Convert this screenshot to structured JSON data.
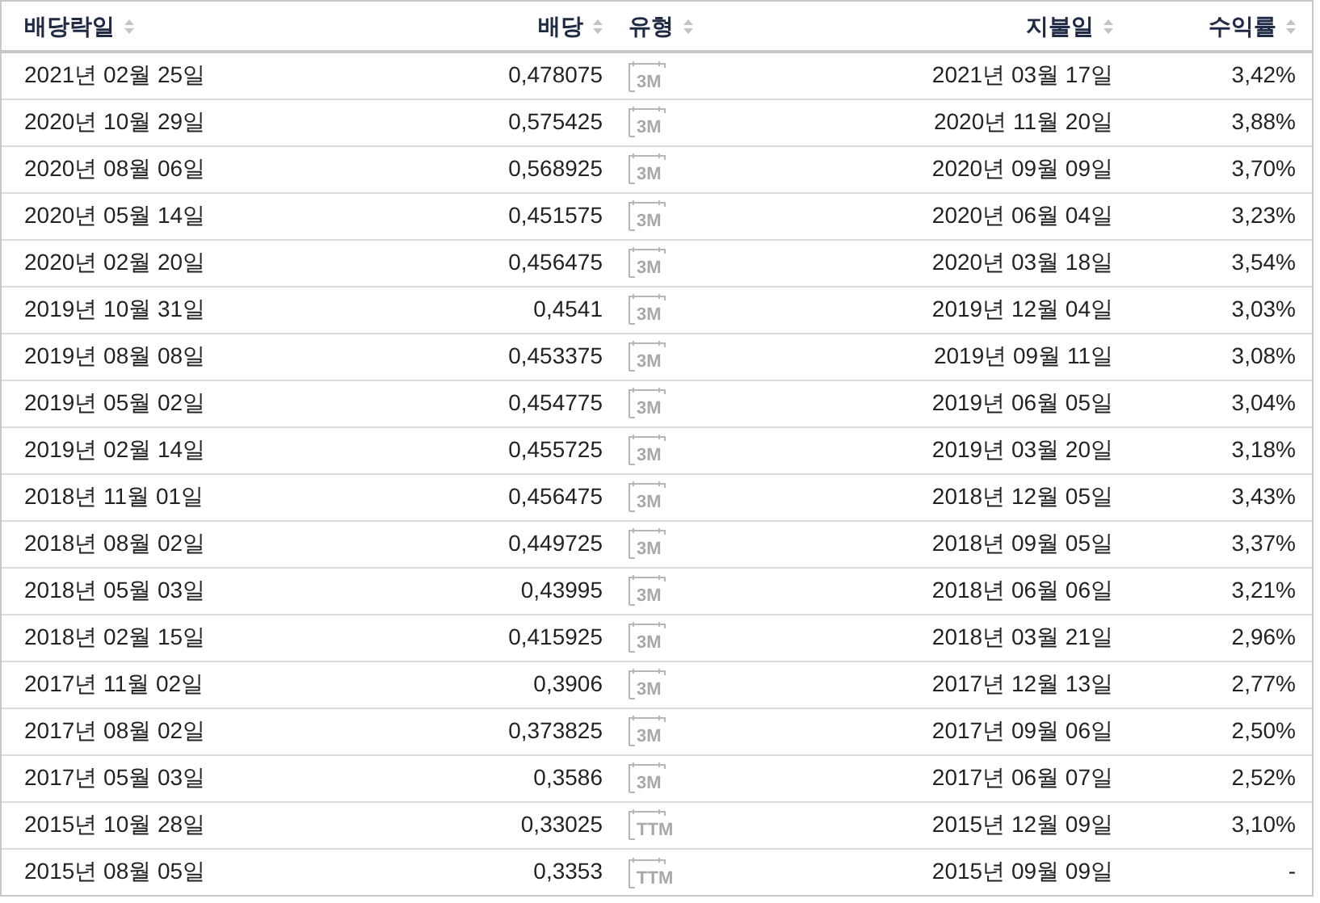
{
  "table": {
    "columns": [
      {
        "label": "배당락일"
      },
      {
        "label": "배당"
      },
      {
        "label": "유형"
      },
      {
        "label": "지불일"
      },
      {
        "label": "수익률"
      }
    ],
    "rows": [
      {
        "ex_date": "2021년 02월 25일",
        "dividend": "0,478075",
        "type": "3M",
        "pay_date": "2021년 03월 17일",
        "yield": "3,42%"
      },
      {
        "ex_date": "2020년 10월 29일",
        "dividend": "0,575425",
        "type": "3M",
        "pay_date": "2020년 11월 20일",
        "yield": "3,88%"
      },
      {
        "ex_date": "2020년 08월 06일",
        "dividend": "0,568925",
        "type": "3M",
        "pay_date": "2020년 09월 09일",
        "yield": "3,70%"
      },
      {
        "ex_date": "2020년 05월 14일",
        "dividend": "0,451575",
        "type": "3M",
        "pay_date": "2020년 06월 04일",
        "yield": "3,23%"
      },
      {
        "ex_date": "2020년 02월 20일",
        "dividend": "0,456475",
        "type": "3M",
        "pay_date": "2020년 03월 18일",
        "yield": "3,54%"
      },
      {
        "ex_date": "2019년 10월 31일",
        "dividend": "0,4541",
        "type": "3M",
        "pay_date": "2019년 12월 04일",
        "yield": "3,03%"
      },
      {
        "ex_date": "2019년 08월 08일",
        "dividend": "0,453375",
        "type": "3M",
        "pay_date": "2019년 09월 11일",
        "yield": "3,08%"
      },
      {
        "ex_date": "2019년 05월 02일",
        "dividend": "0,454775",
        "type": "3M",
        "pay_date": "2019년 06월 05일",
        "yield": "3,04%"
      },
      {
        "ex_date": "2019년 02월 14일",
        "dividend": "0,455725",
        "type": "3M",
        "pay_date": "2019년 03월 20일",
        "yield": "3,18%"
      },
      {
        "ex_date": "2018년 11월 01일",
        "dividend": "0,456475",
        "type": "3M",
        "pay_date": "2018년 12월 05일",
        "yield": "3,43%"
      },
      {
        "ex_date": "2018년 08월 02일",
        "dividend": "0,449725",
        "type": "3M",
        "pay_date": "2018년 09월 05일",
        "yield": "3,37%"
      },
      {
        "ex_date": "2018년 05월 03일",
        "dividend": "0,43995",
        "type": "3M",
        "pay_date": "2018년 06월 06일",
        "yield": "3,21%"
      },
      {
        "ex_date": "2018년 02월 15일",
        "dividend": "0,415925",
        "type": "3M",
        "pay_date": "2018년 03월 21일",
        "yield": "2,96%"
      },
      {
        "ex_date": "2017년 11월 02일",
        "dividend": "0,3906",
        "type": "3M",
        "pay_date": "2017년 12월 13일",
        "yield": "2,77%"
      },
      {
        "ex_date": "2017년 08월 02일",
        "dividend": "0,373825",
        "type": "3M",
        "pay_date": "2017년 09월 06일",
        "yield": "2,50%"
      },
      {
        "ex_date": "2017년 05월 03일",
        "dividend": "0,3586",
        "type": "3M",
        "pay_date": "2017년 06월 07일",
        "yield": "2,52%"
      },
      {
        "ex_date": "2015년 10월 28일",
        "dividend": "0,33025",
        "type": "TTM",
        "pay_date": "2015년 12월 09일",
        "yield": "3,10%"
      },
      {
        "ex_date": "2015년 08월 05일",
        "dividend": "0,3353",
        "type": "TTM",
        "pay_date": "2015년 09월 09일",
        "yield": "-"
      }
    ]
  }
}
